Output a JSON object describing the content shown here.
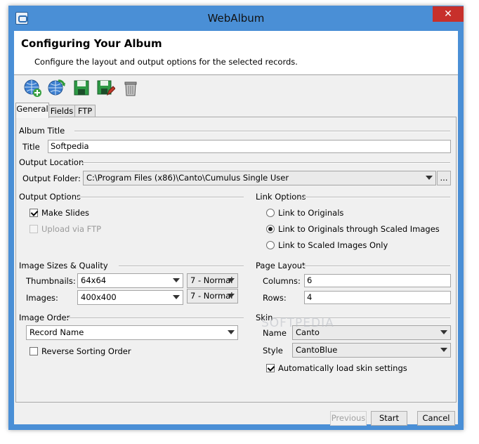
{
  "window": {
    "title": "WebAlbum",
    "close_glyph": "✕"
  },
  "header": {
    "title": "Configuring Your Album",
    "description": "Configure the layout and output options for the selected records."
  },
  "toolbar": {
    "buttons": [
      {
        "icon": "globe-add-icon"
      },
      {
        "icon": "globe-refresh-icon"
      },
      {
        "icon": "save-icon"
      },
      {
        "icon": "save-as-icon"
      },
      {
        "icon": "trash-icon"
      }
    ]
  },
  "tabs": [
    {
      "label": "General",
      "active": true
    },
    {
      "label": "Fields",
      "active": false
    },
    {
      "label": "FTP",
      "active": false
    }
  ],
  "album_title": {
    "section": "Album Title",
    "label": "Title",
    "value": "Softpedia"
  },
  "output_location": {
    "section": "Output Location",
    "folder_label": "Output Folder:",
    "folder_value": "C:\\Program Files (x86)\\Canto\\Cumulus Single User",
    "browse_label": "..."
  },
  "output_options": {
    "section": "Output Options",
    "make_slides": {
      "label": "Make Slides",
      "checked": true
    },
    "upload_ftp": {
      "label": "Upload via FTP",
      "checked": false,
      "enabled": false
    }
  },
  "link_options": {
    "section": "Link Options",
    "options": [
      {
        "label": "Link to Originals",
        "selected": false
      },
      {
        "label": "Link to Originals through Scaled Images",
        "selected": true
      },
      {
        "label": "Link to Scaled Images Only",
        "selected": false
      }
    ]
  },
  "image_sizes": {
    "section": "Image Sizes & Quality",
    "thumbnails_label": "Thumbnails:",
    "thumbnails_size": "64x64",
    "thumbnails_quality": "7 - Normal",
    "images_label": "Images:",
    "images_size": "400x400",
    "images_quality": "7 - Normal"
  },
  "page_layout": {
    "section": "Page Layout",
    "columns_label": "Columns:",
    "columns_value": "6",
    "rows_label": "Rows:",
    "rows_value": "4"
  },
  "image_order": {
    "section": "Image Order",
    "order_value": "Record Name",
    "reverse": {
      "label": "Reverse Sorting Order",
      "checked": false
    }
  },
  "skin": {
    "section": "Skin",
    "name_label": "Name",
    "name_value": "Canto",
    "style_label": "Style",
    "style_value": "CantoBlue",
    "auto_load": {
      "label": "Automatically load skin settings",
      "checked": true
    }
  },
  "watermark": "SOFTPEDIA",
  "footer": {
    "previous_label": "Previous",
    "start_label": "Start",
    "cancel_label": "Cancel"
  }
}
